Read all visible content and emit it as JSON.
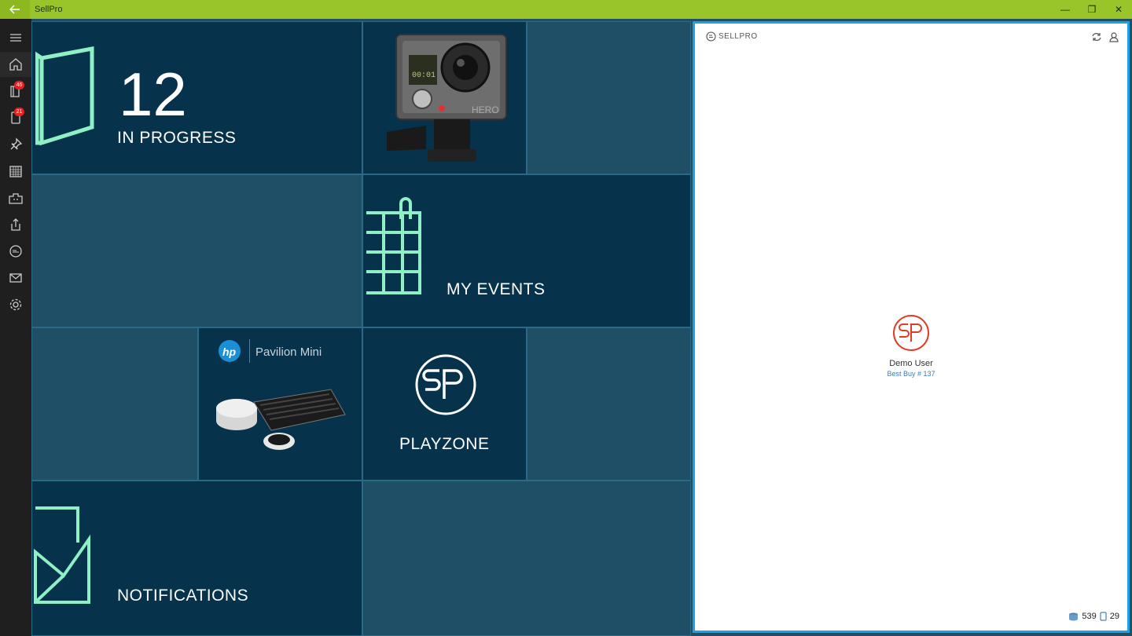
{
  "app": {
    "title": "SellPro"
  },
  "titlebar": {
    "back_icon": "back-arrow-icon",
    "minimize": "—",
    "restore": "❐",
    "close": "✕"
  },
  "sidebar": {
    "items": [
      {
        "name": "menu",
        "icon": "hamburger-icon"
      },
      {
        "name": "home",
        "icon": "home-icon",
        "active": true
      },
      {
        "name": "library",
        "icon": "book-icon",
        "badge": "46"
      },
      {
        "name": "devices",
        "icon": "tablet-icon",
        "badge": "21"
      },
      {
        "name": "pinned",
        "icon": "pin-icon"
      },
      {
        "name": "calendar",
        "icon": "calendar-icon"
      },
      {
        "name": "store",
        "icon": "store-icon"
      },
      {
        "name": "share",
        "icon": "share-icon"
      },
      {
        "name": "sellpro",
        "icon": "sellpro-icon"
      },
      {
        "name": "mail",
        "icon": "mail-icon"
      },
      {
        "name": "settings",
        "icon": "gear-icon"
      }
    ]
  },
  "tiles": {
    "in_progress": {
      "count": "12",
      "label": "IN PROGRESS"
    },
    "events": {
      "label": "MY EVENTS"
    },
    "playzone": {
      "label": "PLAYZONE",
      "logo": "SP"
    },
    "notifications": {
      "label": "NOTIFICATIONS"
    },
    "camera": {
      "brand": "HERO",
      "screen": "00:01"
    },
    "hp": {
      "brand": "hp",
      "product": "Pavilion Mini"
    }
  },
  "panel": {
    "logo_text": "SELLPRO",
    "user": {
      "name": "Demo User",
      "store": "Best Buy # 137",
      "avatar": "SP"
    },
    "stats": {
      "items": "539",
      "devices": "29"
    }
  },
  "colors": {
    "accent": "#9ac52a",
    "tile_dark": "#06324b",
    "tile_mid": "#1f4f66",
    "mint": "#8ef0c4",
    "panel_border": "#1da1e0",
    "avatar_red": "#e23a25"
  }
}
